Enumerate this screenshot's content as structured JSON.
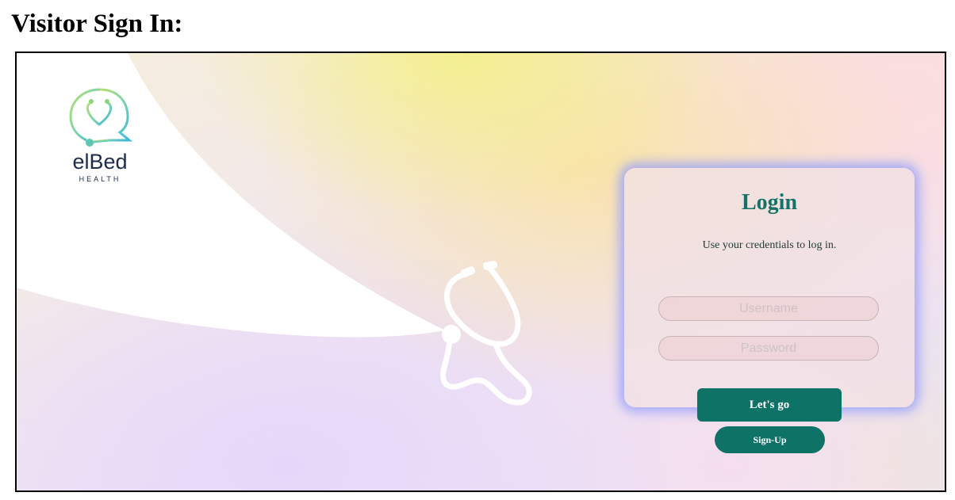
{
  "page": {
    "title": "Visitor Sign In:"
  },
  "brand": {
    "name": "elBed",
    "tagline": "HEALTH",
    "logo_icon": "stethoscope-chat-bubble-icon",
    "color_primary": "#0e7266"
  },
  "login": {
    "title": "Login",
    "subtitle": "Use your credentials to log in.",
    "username": {
      "value": "",
      "placeholder": "Username"
    },
    "password": {
      "value": "",
      "placeholder": "Password"
    },
    "submit_label": "Let's go",
    "signup_label": "Sign-Up"
  },
  "decor": {
    "illustration_icon": "stethoscope-icon",
    "background": "pastel-gradient"
  }
}
